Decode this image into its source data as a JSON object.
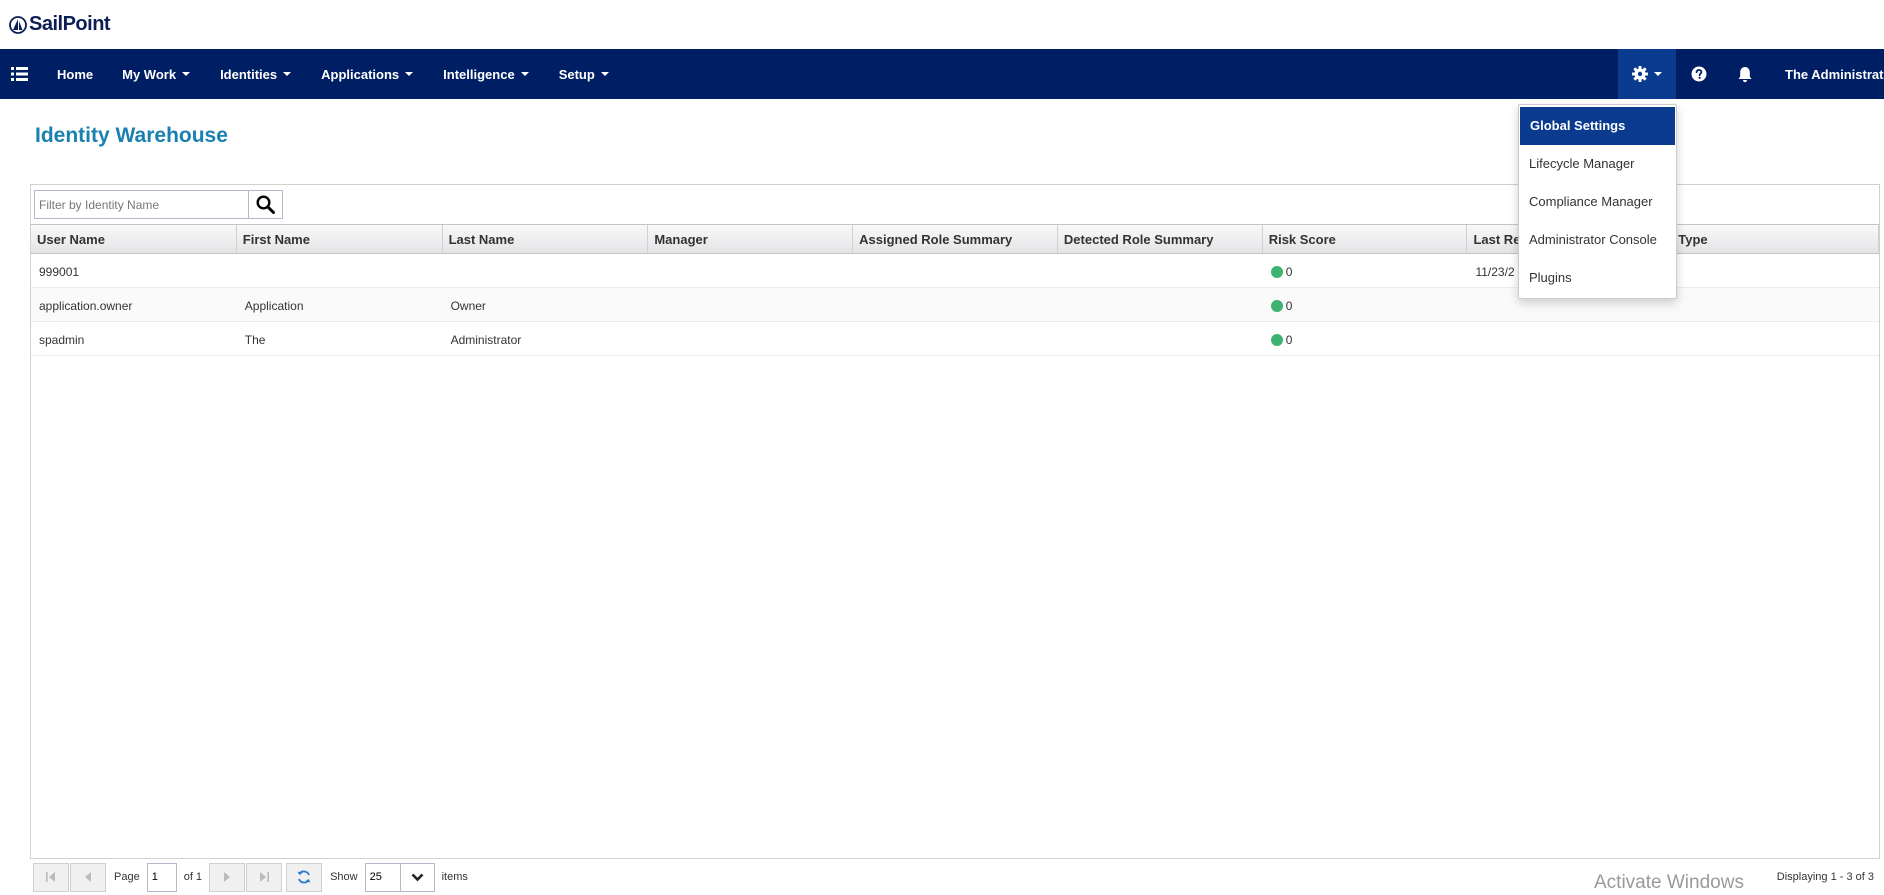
{
  "brand": {
    "name": "SailPoint"
  },
  "nav": {
    "items": [
      {
        "label": "Home",
        "has_caret": false
      },
      {
        "label": "My Work",
        "has_caret": true
      },
      {
        "label": "Identities",
        "has_caret": true
      },
      {
        "label": "Applications",
        "has_caret": true
      },
      {
        "label": "Intelligence",
        "has_caret": true
      },
      {
        "label": "Setup",
        "has_caret": true
      }
    ],
    "user": "The Administrator"
  },
  "settings_menu": {
    "items": [
      "Global Settings",
      "Lifecycle Manager",
      "Compliance Manager",
      "Administrator Console",
      "Plugins"
    ],
    "active": "Global Settings"
  },
  "page": {
    "title": "Identity Warehouse"
  },
  "filter": {
    "placeholder": "Filter by Identity Name",
    "value": ""
  },
  "table": {
    "columns": [
      "User Name",
      "First Name",
      "Last Name",
      "Manager",
      "Assigned Role Summary",
      "Detected Role Summary",
      "Risk Score",
      "Last Refresh",
      "Type"
    ],
    "rows": [
      {
        "user_name": "999001",
        "first_name": "",
        "last_name": "",
        "manager": "",
        "assigned": "",
        "detected": "",
        "risk": "0",
        "last_refresh": "11/23/2",
        "type": ""
      },
      {
        "user_name": "application.owner",
        "first_name": "Application",
        "last_name": "Owner",
        "manager": "",
        "assigned": "",
        "detected": "",
        "risk": "0",
        "last_refresh": "",
        "type": ""
      },
      {
        "user_name": "spadmin",
        "first_name": "The",
        "last_name": "Administrator",
        "manager": "",
        "assigned": "",
        "detected": "",
        "risk": "0",
        "last_refresh": "",
        "type": ""
      }
    ]
  },
  "pager": {
    "page_label": "Page",
    "page_value": "1",
    "of_label": "of 1",
    "show_label": "Show",
    "show_value": "25",
    "items_label": "items",
    "displaying": "Displaying 1 - 3 of 3"
  },
  "watermark": "Activate Windows",
  "colors": {
    "navbar": "#001e64",
    "accent": "#0b3b8f",
    "title": "#1a80b0",
    "risk_low": "#3cb371"
  }
}
